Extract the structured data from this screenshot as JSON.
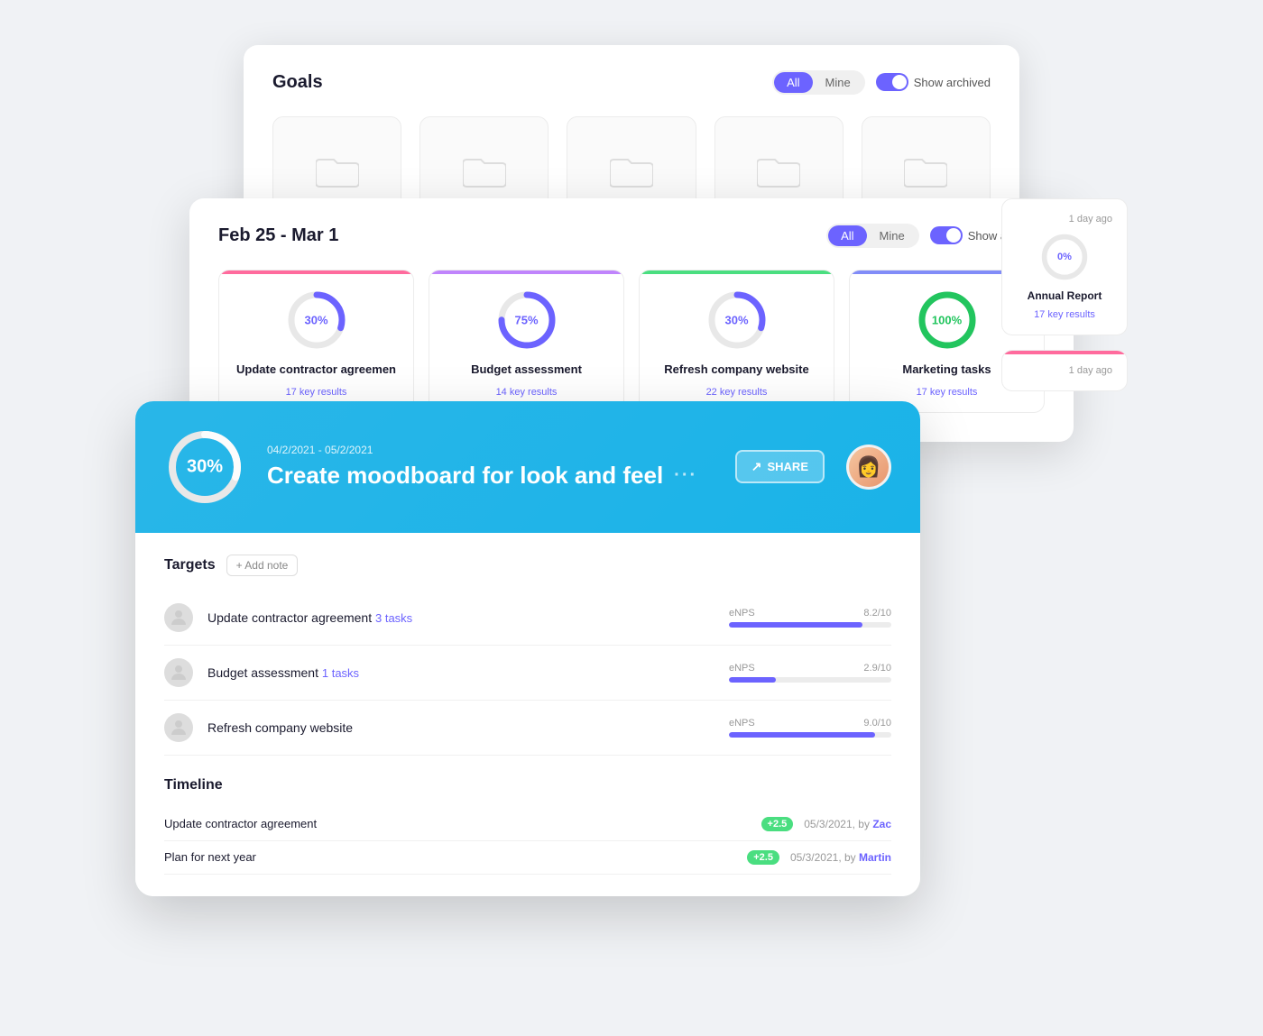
{
  "goals_panel": {
    "title": "Goals",
    "filter_all": "All",
    "filter_mine": "Mine",
    "toggle_label": "Show archived",
    "folders": [
      {
        "id": 1
      },
      {
        "id": 2
      },
      {
        "id": 3
      },
      {
        "id": 4
      },
      {
        "id": 5
      }
    ]
  },
  "mid_panel": {
    "title": "Feb 25 - Mar 1",
    "filter_all": "All",
    "filter_mine": "Mine",
    "toggle_label": "Show archived",
    "goal_cards": [
      {
        "pct": 30,
        "pct_label": "30%",
        "name": "Update contractor agreemen",
        "sub": "17 key results",
        "color": "pink",
        "donut_color": "purple"
      },
      {
        "pct": 75,
        "pct_label": "75%",
        "name": "Budget assessment",
        "sub": "14 key results",
        "color": "purple",
        "donut_color": "purple"
      },
      {
        "pct": 30,
        "pct_label": "30%",
        "name": "Refresh company website",
        "sub": "22 key results",
        "color": "green",
        "donut_color": "purple"
      },
      {
        "pct": 100,
        "pct_label": "100%",
        "name": "Marketing tasks",
        "sub": "17 key results",
        "color": "violet",
        "donut_color": "green"
      }
    ]
  },
  "side_cards": [
    {
      "timestamp": "1 day ago",
      "pct": 0,
      "pct_label": "0%",
      "name": "Annual Report",
      "sub": "17 key results",
      "color": "magenta",
      "donut_color": "purple"
    },
    {
      "timestamp": "1 day ago"
    }
  ],
  "detail_panel": {
    "date_range": "04/2/2021 - 05/2/2021",
    "title": "Create moodboard for look and feel",
    "pct": 30,
    "pct_label": "30%",
    "share_label": "SHARE",
    "targets_title": "Targets",
    "add_note_label": "+ Add note",
    "targets": [
      {
        "name": "Update contractor agreement",
        "tasks": "3 tasks",
        "metric_label": "eNPS",
        "metric_value": "8.2/10",
        "metric_pct": 82,
        "avatar_emoji": "👤"
      },
      {
        "name": "Budget assessment",
        "tasks": "1 tasks",
        "metric_label": "eNPS",
        "metric_value": "2.9/10",
        "metric_pct": 29,
        "avatar_emoji": "👤"
      },
      {
        "name": "Refresh company website",
        "tasks": "",
        "metric_label": "eNPS",
        "metric_value": "9.0/10",
        "metric_pct": 90,
        "avatar_emoji": "👤"
      }
    ],
    "timeline_title": "Timeline",
    "timeline_rows": [
      {
        "name": "Update contractor agreement",
        "badge": "+2.5",
        "date": "05/3/2021, by ",
        "by": "Zac",
        "by_class": "zac"
      },
      {
        "name": "Plan for next year",
        "badge": "+2.5",
        "date": "05/3/2021, by ",
        "by": "Martin",
        "by_class": "martin"
      }
    ]
  }
}
